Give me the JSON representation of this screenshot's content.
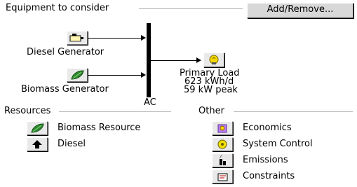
{
  "equipment": {
    "title": "Equipment to consider",
    "add_remove_button": "Add/Remove...",
    "diesel_generator": "Diesel Generator",
    "biomass_generator": "Biomass Generator",
    "bus_label": "AC",
    "load_name": "Primary Load",
    "load_energy": "623 kWh/d",
    "load_peak": "59 kW peak"
  },
  "resources": {
    "title": "Resources",
    "items": [
      {
        "label": "Biomass Resource",
        "icon": "leaf-icon"
      },
      {
        "label": "Diesel",
        "icon": "fuel-pump-icon"
      }
    ]
  },
  "other": {
    "title": "Other",
    "items": [
      {
        "label": "Economics",
        "icon": "economics-icon"
      },
      {
        "label": "System Control",
        "icon": "system-control-icon"
      },
      {
        "label": "Emissions",
        "icon": "emissions-icon"
      },
      {
        "label": "Constraints",
        "icon": "constraints-icon"
      }
    ]
  },
  "colors": {
    "leaf_green": "#2e8b2e",
    "load_yellow": "#f5d800",
    "groupbox_line": "#b8b8b8"
  }
}
